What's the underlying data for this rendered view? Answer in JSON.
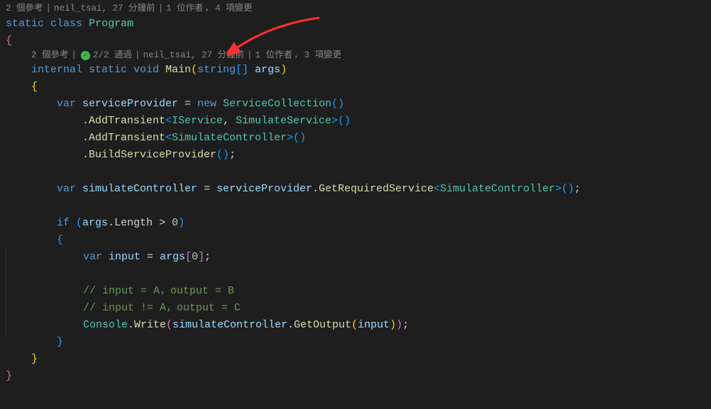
{
  "codelens1": {
    "ref": "2 個參考",
    "author": "neil_tsai, 27 分鐘前",
    "authors": "1 位作者",
    "changes": "4 項變更"
  },
  "codelens2": {
    "ref": "2 個參考",
    "tests": "2/2 通過",
    "author": "neil_tsai, 27 分鐘前",
    "authors": "1 位作者",
    "changes": "3 項變更"
  },
  "code": {
    "kw_static": "static",
    "kw_class": "class",
    "type_program": "Program",
    "kw_internal": "internal",
    "kw_void": "void",
    "method_main": "Main",
    "type_string": "string",
    "brackets": "[]",
    "param_args": "args",
    "kw_var": "var",
    "local_sp": "serviceProvider",
    "kw_new": "new",
    "type_sc": "ServiceCollection",
    "method_addt": "AddTransient",
    "type_iservice": "IService",
    "type_simservice": "SimulateService",
    "type_simctrl": "SimulateController",
    "method_build": "BuildServiceProvider",
    "local_simctrl": "simulateController",
    "method_getreq": "GetRequiredService",
    "kw_if": "if",
    "prop_length": "Length",
    "num_zero": "0",
    "local_input": "input",
    "comment1": "// input = A，output = B",
    "comment2": "// input != A，output = C",
    "type_console": "Console",
    "method_write": "Write",
    "method_getout": "GetOutput",
    "eq": " = ",
    "gt": " > ",
    "comma": ", ",
    "dot": ".",
    "semi": ";",
    "lparen": "(",
    "rparen": ")",
    "lbrace": "{",
    "rbrace": "}",
    "langle": "<",
    "rangle": ">",
    "lsq": "[",
    "rsq": "]",
    "empty_parens": "()"
  }
}
